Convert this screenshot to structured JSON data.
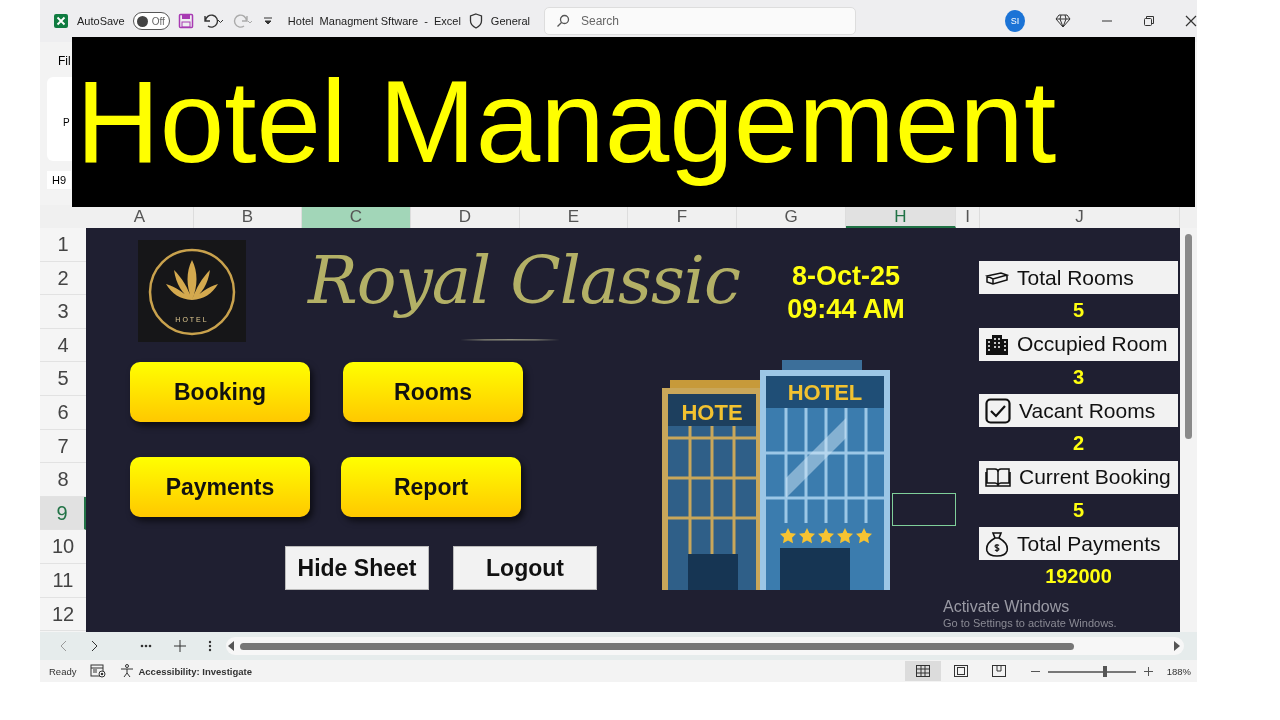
{
  "title_bar": {
    "autosave_label": "AutoSave",
    "autosave_toggle": {
      "label": "Off",
      "on": false
    },
    "title": "Hotel  Managment Sftware  -  Excel",
    "sensitivity": "General",
    "search": {
      "placeholder": "Search"
    },
    "avatar": "SI"
  },
  "ribbon": {
    "tab": "Fil",
    "button": "P",
    "name_box": "H9"
  },
  "banner": {
    "title": "Hotel Management"
  },
  "columns": [
    {
      "label": "A",
      "selected": false,
      "highlighted": false
    },
    {
      "label": "B",
      "selected": false,
      "highlighted": false
    },
    {
      "label": "C",
      "selected": false,
      "highlighted": true
    },
    {
      "label": "D",
      "selected": false,
      "highlighted": false
    },
    {
      "label": "E",
      "selected": false,
      "highlighted": false
    },
    {
      "label": "F",
      "selected": false,
      "highlighted": false
    },
    {
      "label": "G",
      "selected": false,
      "highlighted": false
    },
    {
      "label": "H",
      "selected": true,
      "highlighted": false
    },
    {
      "label": "I",
      "selected": false,
      "highlighted": false
    },
    {
      "label": "J",
      "selected": false,
      "highlighted": false
    }
  ],
  "rows": [
    {
      "label": "1",
      "selected": false
    },
    {
      "label": "2",
      "selected": false
    },
    {
      "label": "3",
      "selected": false
    },
    {
      "label": "4",
      "selected": false
    },
    {
      "label": "5",
      "selected": false
    },
    {
      "label": "6",
      "selected": false
    },
    {
      "label": "7",
      "selected": false
    },
    {
      "label": "8",
      "selected": false
    },
    {
      "label": "9",
      "selected": true
    },
    {
      "label": "10",
      "selected": false
    },
    {
      "label": "11",
      "selected": false
    },
    {
      "label": "12",
      "selected": false
    }
  ],
  "dashboard": {
    "logo_text": "HOTEL",
    "brand": "Royal Classic",
    "date": "8-Oct-25",
    "time": "09:44 AM",
    "nav_buttons": [
      "Booking",
      "Rooms",
      "Payments",
      "Report"
    ],
    "plain_buttons": [
      "Hide Sheet",
      "Logout"
    ],
    "signs": [
      "HOTE",
      "HOTEL"
    ],
    "stats": [
      {
        "kind": "bed",
        "label": "Total Rooms",
        "value": "5"
      },
      {
        "kind": "building",
        "label": "Occupied Room",
        "value": "3"
      },
      {
        "kind": "check",
        "label": "Vacant Rooms",
        "value": "2"
      },
      {
        "kind": "book",
        "label": "Current Booking",
        "value": "5"
      },
      {
        "kind": "money",
        "label": "Total Payments",
        "value": "192000"
      }
    ]
  },
  "activation_notice": {
    "title": "Activate Windows",
    "hint": "Go to Settings to activate Windows."
  },
  "status_bar": {
    "status": "Ready",
    "accessibility": "Accessibility: Investigate",
    "views": [
      {
        "kind": "normal",
        "selected": true
      },
      {
        "kind": "page-layout",
        "selected": false
      },
      {
        "kind": "page-break",
        "selected": false
      }
    ],
    "zoom": {
      "level": 0.65,
      "label": "188%"
    }
  }
}
